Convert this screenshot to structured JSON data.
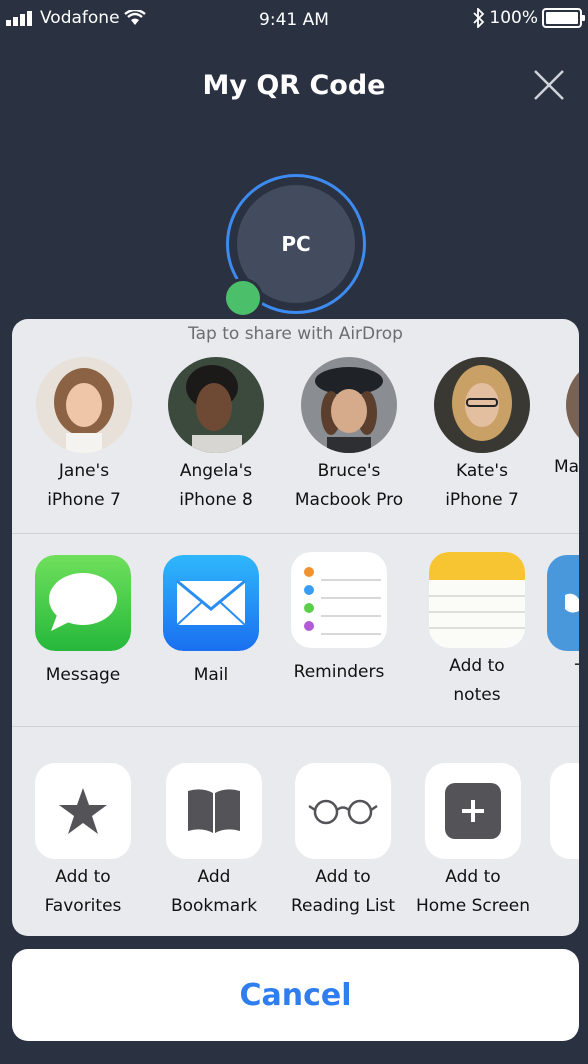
{
  "status_bar": {
    "carrier": "Vodafone",
    "time": "9:41 AM",
    "battery": "100%"
  },
  "header": {
    "title": "My QR Code"
  },
  "avatar": {
    "initials": "PC"
  },
  "share_sheet": {
    "airdrop_hint": "Tap to share with AirDrop",
    "airdrop_targets": [
      {
        "line1": "Jane's",
        "line2": "iPhone 7"
      },
      {
        "line1": "Angela's",
        "line2": "iPhone 8"
      },
      {
        "line1": "Bruce's",
        "line2": "Macbook Pro"
      },
      {
        "line1": "Kate's",
        "line2": "iPhone 7"
      },
      {
        "line1": "",
        "line2": "Ma"
      }
    ],
    "apps": [
      {
        "line1": "Message",
        "line2": ""
      },
      {
        "line1": "Mail",
        "line2": ""
      },
      {
        "line1": "Reminders",
        "line2": ""
      },
      {
        "line1": "Add to",
        "line2": "notes"
      },
      {
        "line1": "Tv",
        "line2": ""
      }
    ],
    "actions": [
      {
        "line1": "Add to",
        "line2": "Favorites"
      },
      {
        "line1": "Add",
        "line2": "Bookmark"
      },
      {
        "line1": "Add to",
        "line2": "Reading List"
      },
      {
        "line1": "Add to",
        "line2": "Home Screen"
      }
    ]
  },
  "cancel_label": "Cancel",
  "colors": {
    "background": "#2a3141",
    "accent": "#2f7ef0",
    "online": "#4cbf6b",
    "ring": "#3d8bf0"
  }
}
